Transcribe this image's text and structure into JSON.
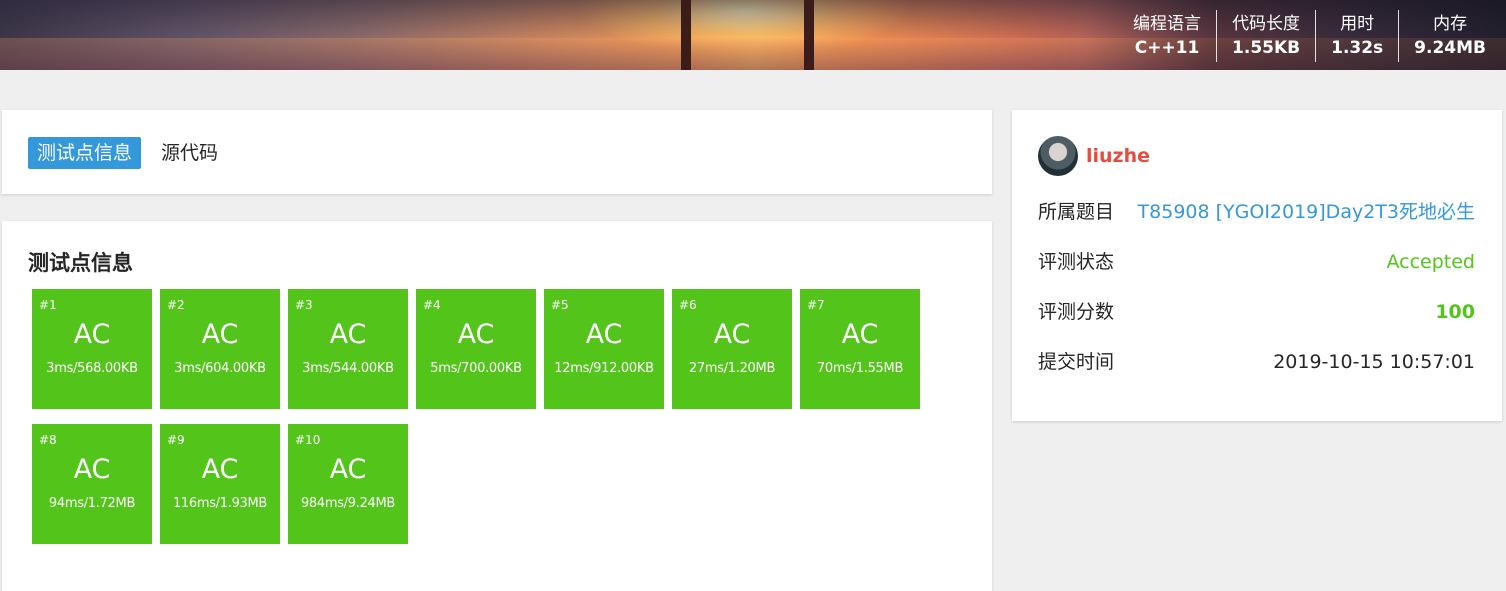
{
  "header": {
    "stats": [
      {
        "label": "编程语言",
        "value": "C++11"
      },
      {
        "label": "代码长度",
        "value": "1.55KB"
      },
      {
        "label": "用时",
        "value": "1.32s"
      },
      {
        "label": "内存",
        "value": "9.24MB"
      }
    ]
  },
  "tabs": [
    {
      "label": "测试点信息",
      "active": true
    },
    {
      "label": "源代码",
      "active": false
    }
  ],
  "testcases": {
    "title": "测试点信息",
    "items": [
      {
        "num": "#1",
        "status": "AC",
        "info": "3ms/568.00KB"
      },
      {
        "num": "#2",
        "status": "AC",
        "info": "3ms/604.00KB"
      },
      {
        "num": "#3",
        "status": "AC",
        "info": "3ms/544.00KB"
      },
      {
        "num": "#4",
        "status": "AC",
        "info": "5ms/700.00KB"
      },
      {
        "num": "#5",
        "status": "AC",
        "info": "12ms/912.00KB"
      },
      {
        "num": "#6",
        "status": "AC",
        "info": "27ms/1.20MB"
      },
      {
        "num": "#7",
        "status": "AC",
        "info": "70ms/1.55MB"
      },
      {
        "num": "#8",
        "status": "AC",
        "info": "94ms/1.72MB"
      },
      {
        "num": "#9",
        "status": "AC",
        "info": "116ms/1.93MB"
      },
      {
        "num": "#10",
        "status": "AC",
        "info": "984ms/9.24MB"
      }
    ]
  },
  "sidebar": {
    "username": "liuzhe",
    "problem_label": "所属题目",
    "problem_value": "T85908 [YGOI2019]Day2T3死地必生",
    "status_label": "评测状态",
    "status_value": "Accepted",
    "score_label": "评测分数",
    "score_value": "100",
    "time_label": "提交时间",
    "time_value": "2019-10-15 10:57:01"
  },
  "colors": {
    "accent": "#3498db",
    "accepted": "#52c41a",
    "username": "#e74c3c"
  }
}
